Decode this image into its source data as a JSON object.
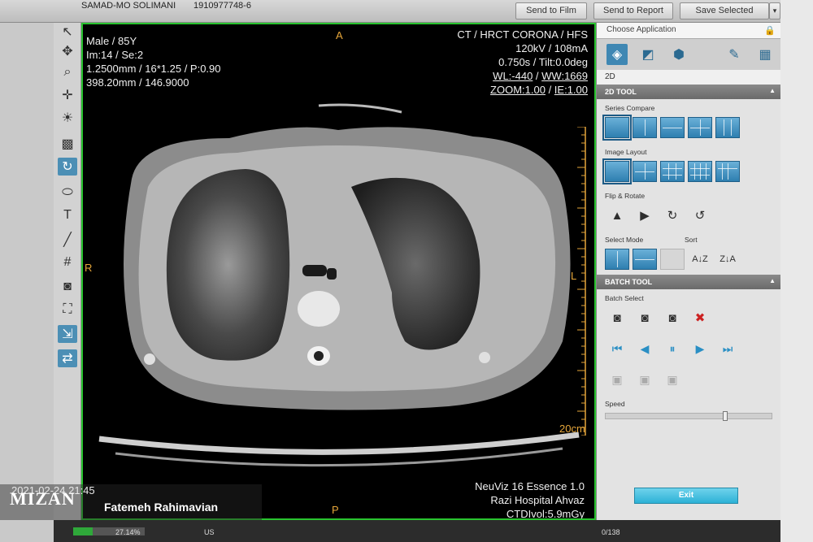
{
  "topbar": {
    "patient_name": "SAMAD-MO SOLIMANI",
    "patient_id": "1910977748-6",
    "send_to_film": "Send to Film",
    "send_to_report": "Send to Report",
    "save_selected": "Save Selected"
  },
  "overlay": {
    "top_left": [
      "Male / 85Y",
      "Im:14 / Se:2",
      "1.2500mm / 16*1.25 / P:0.90",
      "398.20mm / 146.9000"
    ],
    "top_right": [
      "CT / HRCT CORONA / HFS",
      "120kV / 108mA",
      "0.750s / Tilt:0.0deg"
    ],
    "wl": "WL:-440",
    "ww": "WW:1669",
    "zoom": "ZOOM:1.00",
    "ie": "IE:1.00",
    "bottom_right": [
      "NeuViz 16 Essence 1.0",
      "Razi Hospital Ahvaz",
      "CTDIvol:5.9mGy"
    ],
    "date": "2021-02-24 21:45",
    "orient_top": "A",
    "orient_left": "R",
    "orient_right": "L",
    "orient_bottom": "P",
    "scale_label": "20cm"
  },
  "rightpanel": {
    "choose_application": "Choose Application",
    "mode": "2D",
    "tool_2d": "2D TOOL",
    "series_compare": "Series Compare",
    "image_layout": "Image Layout",
    "flip_rotate": "Flip & Rotate",
    "select_mode": "Select Mode",
    "sort": "Sort",
    "batch_tool": "BATCH TOOL",
    "batch_select": "Batch Select",
    "speed": "Speed",
    "exit": "Exit"
  },
  "statusbar": {
    "zoom_percent": "27.14%",
    "language": "US",
    "frame": "0/138",
    "progress": 0.27
  },
  "watermark": {
    "brand": "MIZAN",
    "photographer": "Fatemeh Rahimavian"
  },
  "speed_level": 0.72,
  "colors": {
    "viewport_border": "#29c42f",
    "overlay_orange": "#e6a63a",
    "panel_blue": "#2e7fb0"
  }
}
